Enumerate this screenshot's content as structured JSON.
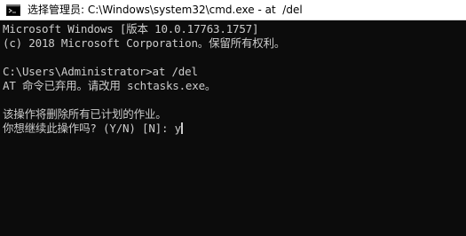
{
  "window": {
    "title": "选择管理员: C:\\Windows\\system32\\cmd.exe - at  /del",
    "icon": "cmd-prompt-icon"
  },
  "console": {
    "lines": [
      "Microsoft Windows [版本 10.0.17763.1757]",
      "(c) 2018 Microsoft Corporation。保留所有权利。",
      "",
      "C:\\Users\\Administrator>at /del",
      "AT 命令已弃用。请改用 schtasks.exe。",
      "",
      "该操作将删除所有已计划的作业。",
      "你想继续此操作吗? (Y/N) [N]: y"
    ]
  },
  "colors": {
    "console_bg": "#0c0c0c",
    "console_text": "#cccccc",
    "titlebar_bg": "#ffffff"
  }
}
